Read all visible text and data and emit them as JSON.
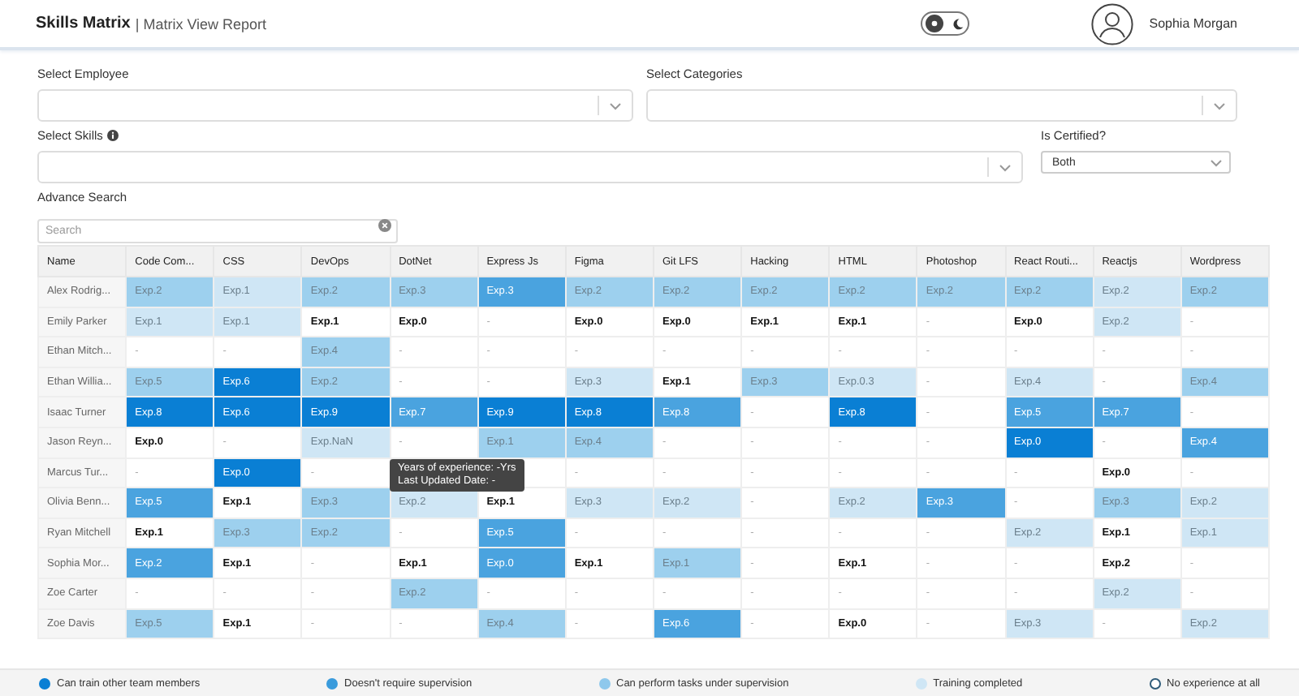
{
  "header": {
    "title": "Skills Matrix",
    "subtitle": "| Matrix View Report",
    "theme_toggle": {
      "on": false
    },
    "user": {
      "name": "Sophia Morgan"
    }
  },
  "filters": {
    "employee": {
      "label": "Select Employee"
    },
    "categories": {
      "label": "Select Categories"
    },
    "skills": {
      "label": "Select Skills"
    },
    "certified": {
      "label": "Is Certified?",
      "value": "Both"
    },
    "search": {
      "label": "Advance Search",
      "placeholder": "Search"
    }
  },
  "table": {
    "name_column": "Name",
    "columns": [
      "Code Com...",
      "CSS",
      "DevOps",
      "DotNet",
      "Express Js",
      "Figma",
      "Git LFS",
      "Hacking",
      "HTML",
      "Photoshop",
      "React Routi...",
      "Reactjs",
      "Wordpress"
    ],
    "rows": [
      {
        "name": "Alex Rodrig...",
        "cells": [
          {
            "text": "Exp.2",
            "color": "#9dd0ee"
          },
          {
            "text": "Exp.1",
            "color": "#cfe6f5"
          },
          {
            "text": "Exp.2",
            "color": "#9dd0ee"
          },
          {
            "text": "Exp.3",
            "color": "#9dd0ee"
          },
          {
            "text": "Exp.3",
            "color": "#4aa3df"
          },
          {
            "text": "Exp.2",
            "color": "#9dd0ee"
          },
          {
            "text": "Exp.2",
            "color": "#9dd0ee"
          },
          {
            "text": "Exp.2",
            "color": "#9dd0ee"
          },
          {
            "text": "Exp.2",
            "color": "#9dd0ee"
          },
          {
            "text": "Exp.2",
            "color": "#9dd0ee"
          },
          {
            "text": "Exp.2",
            "color": "#9dd0ee"
          },
          {
            "text": "Exp.2",
            "color": "#cfe6f5"
          },
          {
            "text": "Exp.2",
            "color": "#9dd0ee"
          }
        ]
      },
      {
        "name": "Emily Parker",
        "cells": [
          {
            "text": "Exp.1",
            "color": "#cfe6f5"
          },
          {
            "text": "Exp.1",
            "color": "#cfe6f5"
          },
          {
            "text": "Exp.1",
            "color": "#ffffff"
          },
          {
            "text": "Exp.0",
            "color": "#ffffff"
          },
          {
            "text": "-",
            "color": "#ffffff"
          },
          {
            "text": "Exp.0",
            "color": "#ffffff"
          },
          {
            "text": "Exp.0",
            "color": "#ffffff"
          },
          {
            "text": "Exp.1",
            "color": "#ffffff"
          },
          {
            "text": "Exp.1",
            "color": "#ffffff"
          },
          {
            "text": "-",
            "color": "#ffffff"
          },
          {
            "text": "Exp.0",
            "color": "#ffffff"
          },
          {
            "text": "Exp.2",
            "color": "#cfe6f5"
          },
          {
            "text": "-",
            "color": "#ffffff"
          }
        ]
      },
      {
        "name": "Ethan Mitch...",
        "cells": [
          {
            "text": "-",
            "color": "#ffffff"
          },
          {
            "text": "-",
            "color": "#ffffff"
          },
          {
            "text": "Exp.4",
            "color": "#9dd0ee"
          },
          {
            "text": "-",
            "color": "#ffffff"
          },
          {
            "text": "-",
            "color": "#ffffff"
          },
          {
            "text": "-",
            "color": "#ffffff"
          },
          {
            "text": "-",
            "color": "#ffffff"
          },
          {
            "text": "-",
            "color": "#ffffff"
          },
          {
            "text": "-",
            "color": "#ffffff"
          },
          {
            "text": "-",
            "color": "#ffffff"
          },
          {
            "text": "-",
            "color": "#ffffff"
          },
          {
            "text": "-",
            "color": "#ffffff"
          },
          {
            "text": "-",
            "color": "#ffffff"
          }
        ]
      },
      {
        "name": "Ethan Willia...",
        "cells": [
          {
            "text": "Exp.5",
            "color": "#9dd0ee"
          },
          {
            "text": "Exp.6",
            "color": "#0a7fd4"
          },
          {
            "text": "Exp.2",
            "color": "#9dd0ee"
          },
          {
            "text": "-",
            "color": "#ffffff"
          },
          {
            "text": "-",
            "color": "#ffffff"
          },
          {
            "text": "Exp.3",
            "color": "#cfe6f5"
          },
          {
            "text": "Exp.1",
            "color": "#ffffff"
          },
          {
            "text": "Exp.3",
            "color": "#9dd0ee"
          },
          {
            "text": "Exp.0.3",
            "color": "#cfe6f5"
          },
          {
            "text": "-",
            "color": "#ffffff"
          },
          {
            "text": "Exp.4",
            "color": "#cfe6f5"
          },
          {
            "text": "-",
            "color": "#ffffff"
          },
          {
            "text": "Exp.4",
            "color": "#9dd0ee"
          }
        ]
      },
      {
        "name": "Isaac Turner",
        "cells": [
          {
            "text": "Exp.8",
            "color": "#0a7fd4"
          },
          {
            "text": "Exp.6",
            "color": "#0a7fd4"
          },
          {
            "text": "Exp.9",
            "color": "#0a7fd4"
          },
          {
            "text": "Exp.7",
            "color": "#4aa3df"
          },
          {
            "text": "Exp.9",
            "color": "#0a7fd4"
          },
          {
            "text": "Exp.8",
            "color": "#0a7fd4"
          },
          {
            "text": "Exp.8",
            "color": "#4aa3df"
          },
          {
            "text": "-",
            "color": "#ffffff"
          },
          {
            "text": "Exp.8",
            "color": "#0a7fd4"
          },
          {
            "text": "-",
            "color": "#ffffff"
          },
          {
            "text": "Exp.5",
            "color": "#4aa3df"
          },
          {
            "text": "Exp.7",
            "color": "#4aa3df"
          },
          {
            "text": "-",
            "color": "#ffffff"
          }
        ]
      },
      {
        "name": "Jason Reyn...",
        "cells": [
          {
            "text": "Exp.0",
            "color": "#ffffff"
          },
          {
            "text": "-",
            "color": "#ffffff"
          },
          {
            "text": "Exp.NaN",
            "color": "#cfe6f5"
          },
          {
            "text": "-",
            "color": "#ffffff"
          },
          {
            "text": "Exp.1",
            "color": "#9dd0ee"
          },
          {
            "text": "Exp.4",
            "color": "#9dd0ee"
          },
          {
            "text": "-",
            "color": "#ffffff"
          },
          {
            "text": "-",
            "color": "#ffffff"
          },
          {
            "text": "-",
            "color": "#ffffff"
          },
          {
            "text": "-",
            "color": "#ffffff"
          },
          {
            "text": "Exp.0",
            "color": "#0a7fd4"
          },
          {
            "text": "-",
            "color": "#ffffff"
          },
          {
            "text": "Exp.4",
            "color": "#4aa3df"
          }
        ]
      },
      {
        "name": "Marcus Tur...",
        "cells": [
          {
            "text": "-",
            "color": "#ffffff"
          },
          {
            "text": "Exp.0",
            "color": "#0a7fd4"
          },
          {
            "text": "-",
            "color": "#ffffff"
          },
          {
            "text": "",
            "color": "#ffffff"
          },
          {
            "text": "",
            "color": "#ffffff"
          },
          {
            "text": "-",
            "color": "#ffffff"
          },
          {
            "text": "-",
            "color": "#ffffff"
          },
          {
            "text": "-",
            "color": "#ffffff"
          },
          {
            "text": "-",
            "color": "#ffffff"
          },
          {
            "text": "-",
            "color": "#ffffff"
          },
          {
            "text": "-",
            "color": "#ffffff"
          },
          {
            "text": "Exp.0",
            "color": "#ffffff"
          },
          {
            "text": "-",
            "color": "#ffffff"
          }
        ]
      },
      {
        "name": "Olivia Benn...",
        "cells": [
          {
            "text": "Exp.5",
            "color": "#4aa3df"
          },
          {
            "text": "Exp.1",
            "color": "#ffffff"
          },
          {
            "text": "Exp.3",
            "color": "#9dd0ee"
          },
          {
            "text": "Exp.2",
            "color": "#cfe6f5"
          },
          {
            "text": "Exp.1",
            "color": "#ffffff"
          },
          {
            "text": "Exp.3",
            "color": "#cfe6f5"
          },
          {
            "text": "Exp.2",
            "color": "#cfe6f5"
          },
          {
            "text": "-",
            "color": "#ffffff"
          },
          {
            "text": "Exp.2",
            "color": "#cfe6f5"
          },
          {
            "text": "Exp.3",
            "color": "#4aa3df"
          },
          {
            "text": "-",
            "color": "#ffffff"
          },
          {
            "text": "Exp.3",
            "color": "#9dd0ee"
          },
          {
            "text": "Exp.2",
            "color": "#cfe6f5"
          }
        ]
      },
      {
        "name": "Ryan Mitchell",
        "cells": [
          {
            "text": "Exp.1",
            "color": "#ffffff"
          },
          {
            "text": "Exp.3",
            "color": "#9dd0ee"
          },
          {
            "text": "Exp.2",
            "color": "#9dd0ee"
          },
          {
            "text": "-",
            "color": "#ffffff"
          },
          {
            "text": "Exp.5",
            "color": "#4aa3df"
          },
          {
            "text": "-",
            "color": "#ffffff"
          },
          {
            "text": "-",
            "color": "#ffffff"
          },
          {
            "text": "-",
            "color": "#ffffff"
          },
          {
            "text": "-",
            "color": "#ffffff"
          },
          {
            "text": "-",
            "color": "#ffffff"
          },
          {
            "text": "Exp.2",
            "color": "#cfe6f5"
          },
          {
            "text": "Exp.1",
            "color": "#ffffff"
          },
          {
            "text": "Exp.1",
            "color": "#cfe6f5"
          }
        ]
      },
      {
        "name": "Sophia Mor...",
        "cells": [
          {
            "text": "Exp.2",
            "color": "#4aa3df"
          },
          {
            "text": "Exp.1",
            "color": "#ffffff"
          },
          {
            "text": "-",
            "color": "#ffffff"
          },
          {
            "text": "Exp.1",
            "color": "#ffffff"
          },
          {
            "text": "Exp.0",
            "color": "#4aa3df"
          },
          {
            "text": "Exp.1",
            "color": "#ffffff"
          },
          {
            "text": "Exp.1",
            "color": "#9dd0ee"
          },
          {
            "text": "-",
            "color": "#ffffff"
          },
          {
            "text": "Exp.1",
            "color": "#ffffff"
          },
          {
            "text": "-",
            "color": "#ffffff"
          },
          {
            "text": "-",
            "color": "#ffffff"
          },
          {
            "text": "Exp.2",
            "color": "#ffffff"
          },
          {
            "text": "-",
            "color": "#ffffff"
          }
        ]
      },
      {
        "name": "Zoe Carter",
        "cells": [
          {
            "text": "-",
            "color": "#ffffff"
          },
          {
            "text": "-",
            "color": "#ffffff"
          },
          {
            "text": "-",
            "color": "#ffffff"
          },
          {
            "text": "Exp.2",
            "color": "#9dd0ee"
          },
          {
            "text": "-",
            "color": "#ffffff"
          },
          {
            "text": "-",
            "color": "#ffffff"
          },
          {
            "text": "-",
            "color": "#ffffff"
          },
          {
            "text": "-",
            "color": "#ffffff"
          },
          {
            "text": "-",
            "color": "#ffffff"
          },
          {
            "text": "-",
            "color": "#ffffff"
          },
          {
            "text": "-",
            "color": "#ffffff"
          },
          {
            "text": "Exp.2",
            "color": "#cfe6f5"
          },
          {
            "text": "-",
            "color": "#ffffff"
          }
        ]
      },
      {
        "name": "Zoe Davis",
        "cells": [
          {
            "text": "Exp.5",
            "color": "#9dd0ee"
          },
          {
            "text": "Exp.1",
            "color": "#ffffff"
          },
          {
            "text": "-",
            "color": "#ffffff"
          },
          {
            "text": "-",
            "color": "#ffffff"
          },
          {
            "text": "Exp.4",
            "color": "#9dd0ee"
          },
          {
            "text": "-",
            "color": "#ffffff"
          },
          {
            "text": "Exp.6",
            "color": "#4aa3df"
          },
          {
            "text": "-",
            "color": "#ffffff"
          },
          {
            "text": "Exp.0",
            "color": "#ffffff"
          },
          {
            "text": "-",
            "color": "#ffffff"
          },
          {
            "text": "Exp.3",
            "color": "#cfe6f5"
          },
          {
            "text": "-",
            "color": "#ffffff"
          },
          {
            "text": "Exp.2",
            "color": "#cfe6f5"
          }
        ]
      }
    ],
    "tooltip": {
      "lines": [
        "Years of experience: -Yrs",
        "Last Updated Date: -"
      ]
    }
  },
  "legend": [
    {
      "label": "Can train other team members",
      "color": "#0a7fd4"
    },
    {
      "label": "Doesn't require supervision",
      "color": "#3a9bdc"
    },
    {
      "label": "Can perform tasks under supervision",
      "color": "#8ec8ec"
    },
    {
      "label": "Training completed",
      "color": "#cfe6f5"
    },
    {
      "label": "No experience at all",
      "color": "#ffffff"
    }
  ]
}
